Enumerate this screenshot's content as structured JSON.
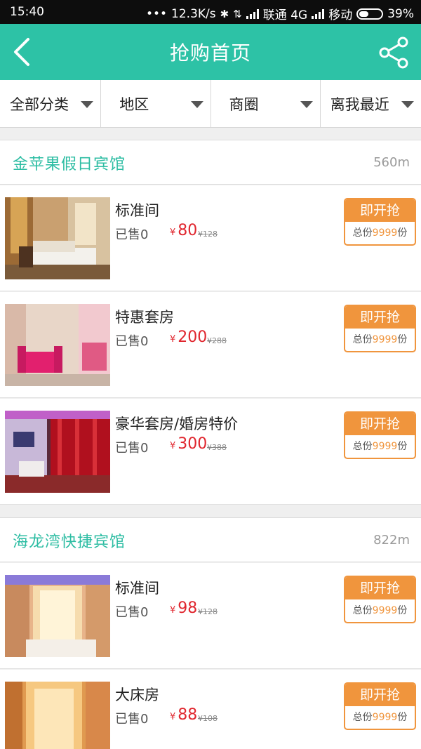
{
  "status": {
    "time": "15:40",
    "dots": "•••",
    "speed": "12.3K/s",
    "carrier1": "联通 4G",
    "carrier2": "移动",
    "battery": "39%"
  },
  "header": {
    "title": "抢购首页"
  },
  "filters": [
    "全部分类",
    "地区",
    "商圈",
    "离我最近"
  ],
  "hotels": [
    {
      "name": "金苹果假日宾馆",
      "distance": "560m",
      "rooms": [
        {
          "name": "标准间",
          "sold": "已售0",
          "currency": "¥",
          "price": "80",
          "original": "¥128",
          "button": "即开抢",
          "qty_prefix": "总份",
          "qty": "9999",
          "qty_suffix": "份"
        },
        {
          "name": "特惠套房",
          "sold": "已售0",
          "currency": "¥",
          "price": "200",
          "original": "¥288",
          "button": "即开抢",
          "qty_prefix": "总份",
          "qty": "9999",
          "qty_suffix": "份"
        },
        {
          "name": "豪华套房/婚房特价",
          "sold": "已售0",
          "currency": "¥",
          "price": "300",
          "original": "¥388",
          "button": "即开抢",
          "qty_prefix": "总份",
          "qty": "9999",
          "qty_suffix": "份"
        }
      ]
    },
    {
      "name": "海龙湾快捷宾馆",
      "distance": "822m",
      "rooms": [
        {
          "name": "标准间",
          "sold": "已售0",
          "currency": "¥",
          "price": "98",
          "original": "¥128",
          "button": "即开抢",
          "qty_prefix": "总份",
          "qty": "9999",
          "qty_suffix": "份"
        },
        {
          "name": "大床房",
          "sold": "已售0",
          "currency": "¥",
          "price": "88",
          "original": "¥108",
          "button": "即开抢",
          "qty_prefix": "总份",
          "qty": "9999",
          "qty_suffix": "份"
        }
      ]
    }
  ],
  "icons": {
    "back": "chevron-left-icon",
    "share": "share-icon",
    "dropdown": "triangle-down-icon",
    "bluetooth": "bluetooth-icon",
    "signal": "signal-icon",
    "battery": "battery-icon"
  },
  "colors": {
    "brand": "#2dc2a6",
    "price": "#e0262e",
    "cta": "#f0953d"
  }
}
